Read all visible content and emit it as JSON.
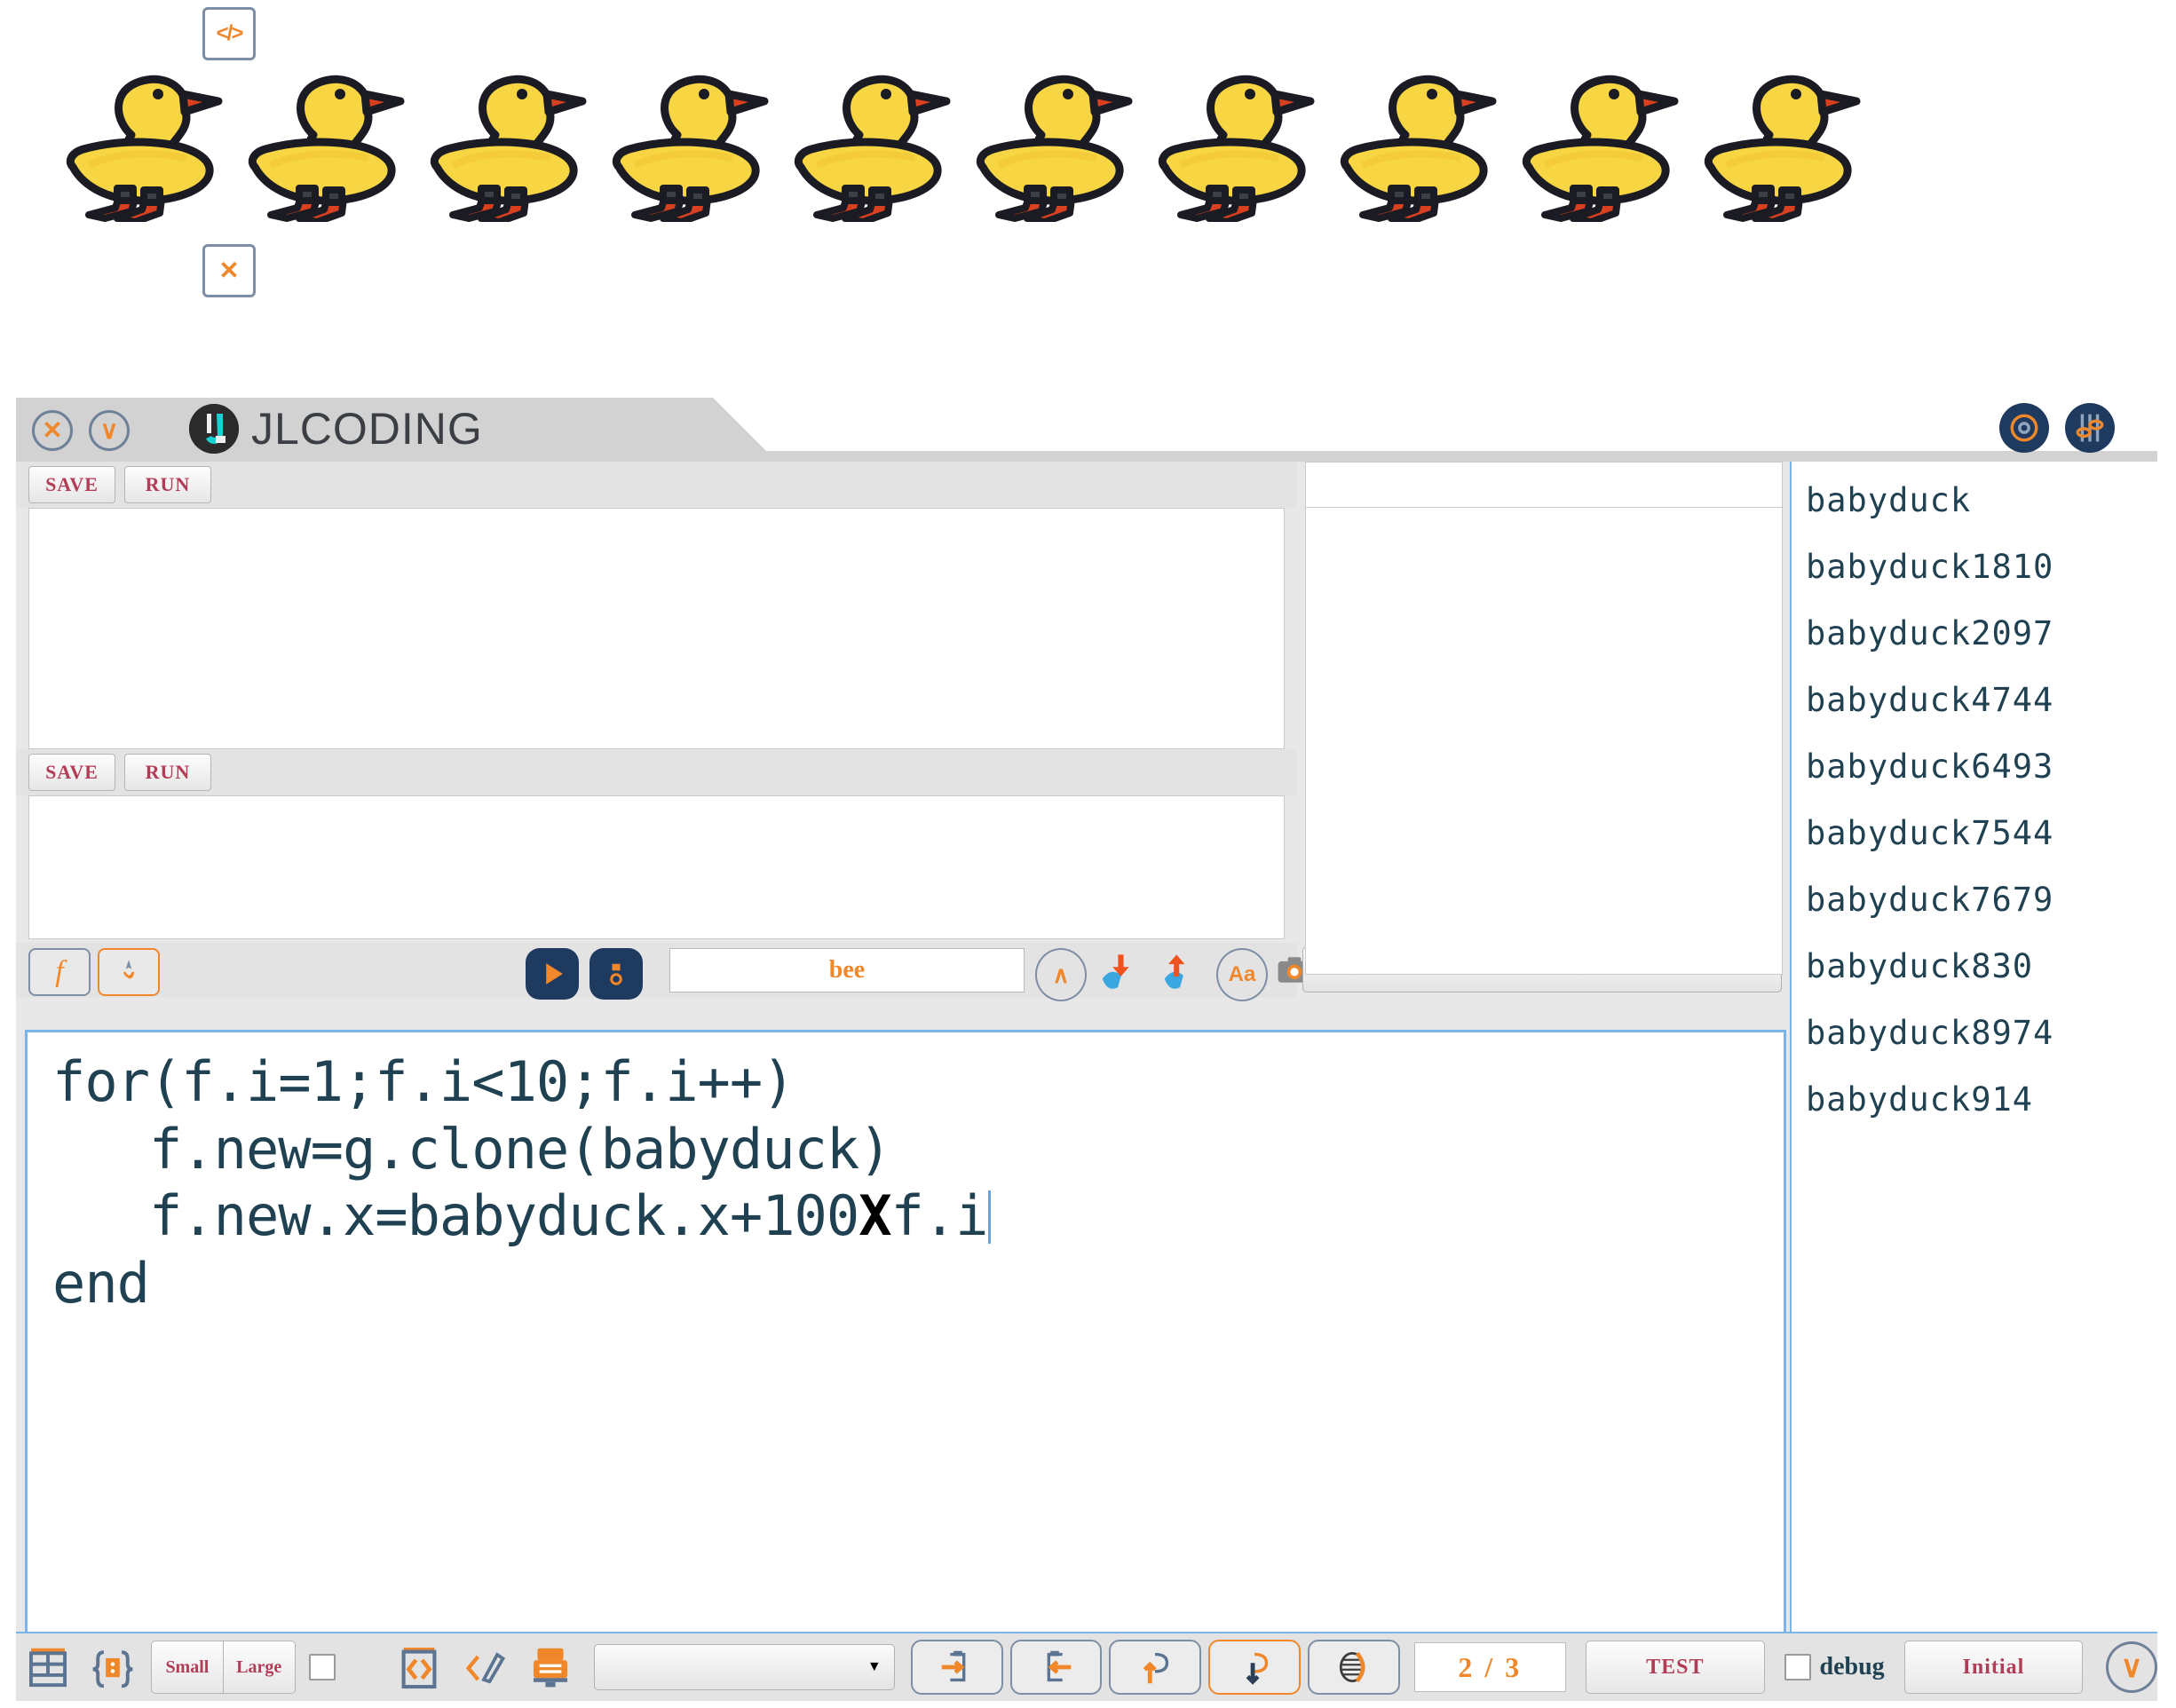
{
  "stage": {
    "duck_count": 10,
    "duck_sprite_name": "babyduck",
    "duck_body_color": "#f7d543",
    "duck_beak_color": "#d8401f",
    "badge_code_label": "</>",
    "badge_close_label": "✕"
  },
  "window": {
    "title": "JLCODING",
    "brand_letter": "JL",
    "close_label": "✕",
    "collapse_label": "∨"
  },
  "editors": {
    "save_label": "SAVE",
    "run_label": "RUN"
  },
  "toolbar": {
    "function_label": "f",
    "name_value": "bee",
    "font_label": "Aa",
    "up_label": "∧",
    "select_value": "",
    "caret_label": "▼"
  },
  "code": {
    "line1": "for(f.i=1;f.i<10;f.i++)",
    "line2": "   f.new=g.clone(babyduck)",
    "line3_pre": "   f.new.x=babyduck.x+100",
    "line3_op": "X",
    "line3_post": "f.i",
    "line4": "end"
  },
  "object_list": {
    "items": [
      "babyduck",
      "babyduck1810",
      "babyduck2097",
      "babyduck4744",
      "babyduck6493",
      "babyduck7544",
      "babyduck7679",
      "babyduck830",
      "babyduck8974",
      "babyduck914"
    ]
  },
  "status_bar": {
    "small_label": "Small",
    "large_label": "Large",
    "select_value": "",
    "caret_label": "▼",
    "page_indicator": "2 / 3",
    "test_label": "TEST",
    "debug_label": "debug",
    "initial_label": "Initial",
    "down_label": "∨"
  },
  "colors": {
    "accent_orange": "#f0872a",
    "code_text": "#1f4152",
    "button_red": "#b33c56",
    "panel_border_blue": "#79b5e8",
    "brand_dark": "#1f3a5f"
  }
}
